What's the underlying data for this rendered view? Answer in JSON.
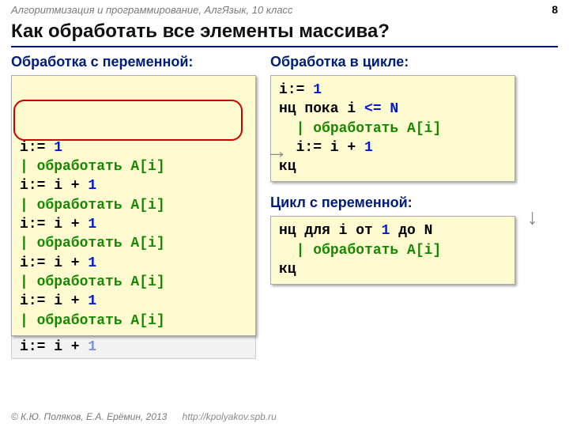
{
  "header": {
    "course": "Алгоритмизация и программирование, АлгЯзык, 10 класс",
    "page": "8"
  },
  "title": "Как обработать все элементы массива?",
  "left": {
    "subtitle": "Обработка с переменной:",
    "lines": [
      [
        {
          "t": "i:= ",
          "c": "kw-k"
        },
        {
          "t": "1",
          "c": "n-blue"
        }
      ],
      [
        {
          "t": "| обработать A[i]",
          "c": "comment"
        }
      ],
      [
        {
          "t": "i:= i + ",
          "c": "kw-k"
        },
        {
          "t": "1",
          "c": "n-blue"
        }
      ],
      [
        {
          "t": "| обработать A[i]",
          "c": "comment"
        }
      ],
      [
        {
          "t": "i:= i + ",
          "c": "kw-k"
        },
        {
          "t": "1",
          "c": "n-blue"
        }
      ],
      [
        {
          "t": "| обработать A[i]",
          "c": "comment"
        }
      ],
      [
        {
          "t": "i:= i + ",
          "c": "kw-k"
        },
        {
          "t": "1",
          "c": "n-blue"
        }
      ],
      [
        {
          "t": "| обработать A[i]",
          "c": "comment"
        }
      ],
      [
        {
          "t": "i:= i + ",
          "c": "kw-k"
        },
        {
          "t": "1",
          "c": "n-blue"
        }
      ],
      [
        {
          "t": "| обработать A[i]",
          "c": "comment"
        }
      ]
    ],
    "extra": [
      {
        "t": "i:= i + ",
        "c": "kw-k"
      },
      {
        "t": "1",
        "c": "n-blue"
      }
    ]
  },
  "right1": {
    "subtitle": "Обработка в цикле:",
    "lines": [
      [
        {
          "t": "i:= ",
          "c": "kw-k"
        },
        {
          "t": "1",
          "c": "n-blue"
        }
      ],
      [
        {
          "t": "нц пока i ",
          "c": "kw-k"
        },
        {
          "t": "<= N",
          "c": "n-blue"
        }
      ],
      [
        {
          "t": "  ",
          "c": "kw-k"
        },
        {
          "t": "| обработать A[i]",
          "c": "comment"
        }
      ],
      [
        {
          "t": "  i:= i + ",
          "c": "kw-k"
        },
        {
          "t": "1",
          "c": "n-blue"
        }
      ],
      [
        {
          "t": "кц",
          "c": "kw-k"
        }
      ]
    ]
  },
  "right2": {
    "subtitle": "Цикл с переменной:",
    "lines": [
      [
        {
          "t": "нц для i от ",
          "c": "kw-k"
        },
        {
          "t": "1",
          "c": "n-blue"
        },
        {
          "t": " до N",
          "c": "kw-k"
        }
      ],
      [
        {
          "t": "  ",
          "c": "kw-k"
        },
        {
          "t": "| обработать A[i]",
          "c": "comment"
        }
      ],
      [
        {
          "t": "кц",
          "c": "kw-k"
        }
      ]
    ]
  },
  "footer": {
    "authors": "© К.Ю. Поляков, Е.А. Ерёмин, 2013",
    "url": "http://kpolyakov.spb.ru"
  },
  "glyphs": {
    "arrow_right": "→"
  }
}
